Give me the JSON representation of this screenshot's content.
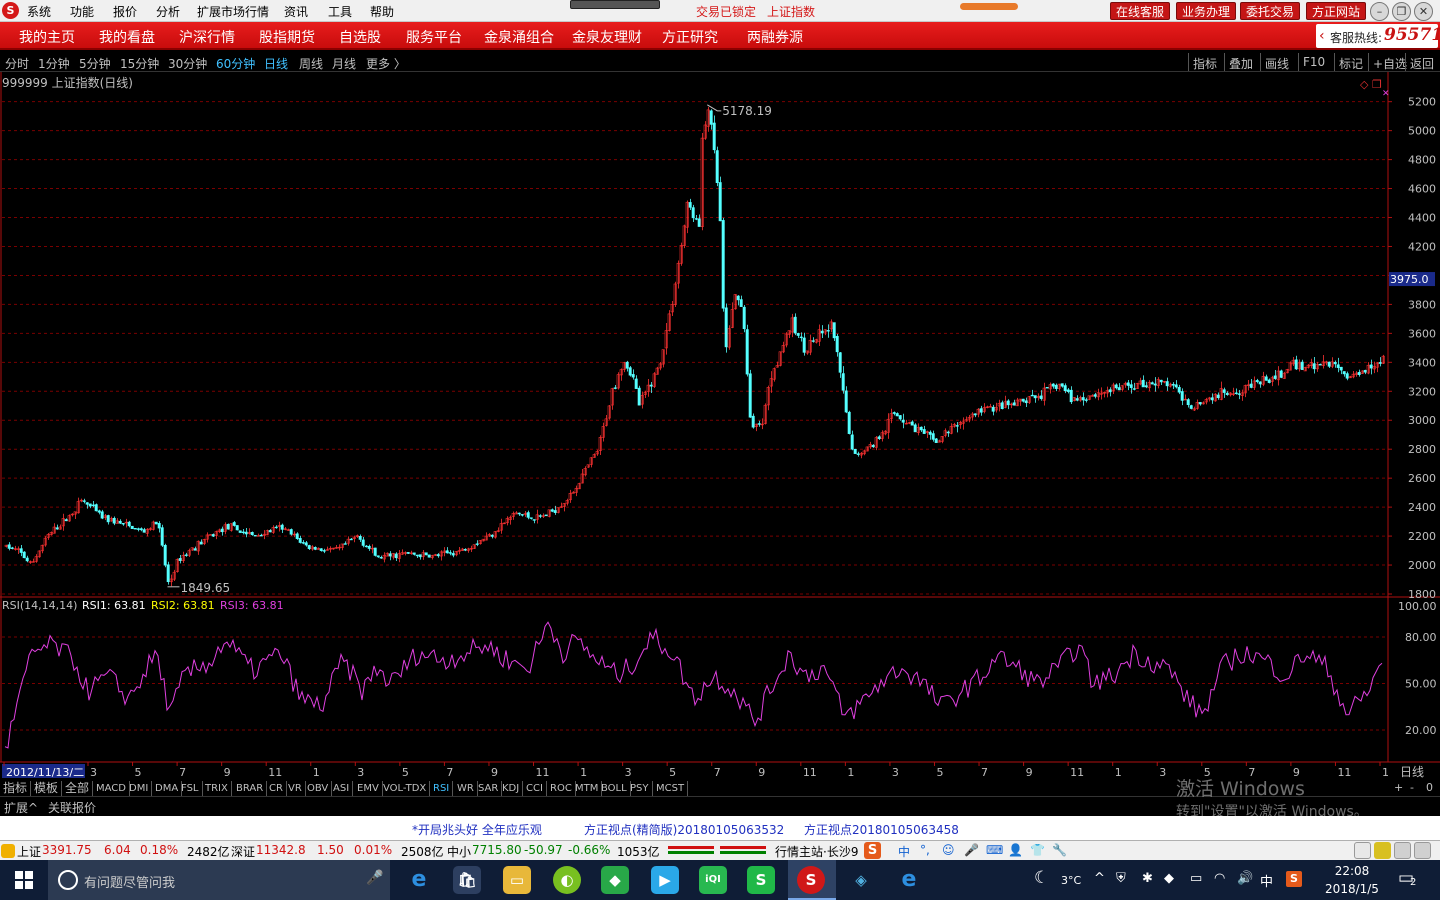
{
  "menubar": {
    "logo": "S",
    "items": [
      "系统",
      "功能",
      "报价",
      "分析",
      "扩展市场行情",
      "资讯",
      "工具",
      "帮助"
    ],
    "lock_status": "交易已锁定",
    "current_index": "上证指数",
    "buttons": [
      "在线客服",
      "业务办理",
      "委托交易",
      "方正网站"
    ]
  },
  "navbar": {
    "items": [
      "我的主页",
      "我的看盘",
      "沪深行情",
      "股指期货",
      "自选股",
      "服务平台",
      "金泉涌组合",
      "金泉友理财",
      "方正研究",
      "两融券源"
    ],
    "hotline_label": "客服热线:",
    "hotline_number": "95571"
  },
  "periodbar": {
    "periods": [
      "分时",
      "1分钟",
      "5分钟",
      "15分钟",
      "30分钟",
      "60分钟",
      "日线",
      "周线",
      "月线",
      "更多 〉"
    ],
    "active_period": "日线",
    "right_items": [
      "指标",
      "叠加",
      "画线",
      "F10",
      "标记",
      "+自选",
      "返回"
    ]
  },
  "chart_data": [
    {
      "type": "candlestick",
      "title": "999999 上证指数(日线)",
      "ylim": [
        1700,
        5300
      ],
      "y_ticks": [
        1800,
        2000,
        2200,
        2400,
        2600,
        2800,
        3000,
        3200,
        3400,
        3600,
        3800,
        4000,
        4200,
        4400,
        4600,
        4800,
        5000,
        5200
      ],
      "y_tick_labels": [
        "1800",
        "2000",
        "2200",
        "2400",
        "2600",
        "2800",
        "3000",
        "3200",
        "3400",
        "3600",
        "3800",
        "",
        "4200",
        "4400",
        "4600",
        "4800",
        "5000",
        "5200"
      ],
      "current_value": "3975.0",
      "high_annotation": "5178.19",
      "low_annotation": "1849.65",
      "high_value": 5178.19,
      "low_value": 1849.65,
      "price_path": [
        [
          0,
          2130
        ],
        [
          0.01,
          2090
        ],
        [
          0.018,
          2000
        ],
        [
          0.03,
          2200
        ],
        [
          0.045,
          2330
        ],
        [
          0.055,
          2450
        ],
        [
          0.07,
          2330
        ],
        [
          0.085,
          2280
        ],
        [
          0.1,
          2230
        ],
        [
          0.11,
          2300
        ],
        [
          0.118,
          1860
        ],
        [
          0.125,
          2040
        ],
        [
          0.14,
          2150
        ],
        [
          0.16,
          2270
        ],
        [
          0.18,
          2200
        ],
        [
          0.2,
          2260
        ],
        [
          0.22,
          2120
        ],
        [
          0.24,
          2100
        ],
        [
          0.255,
          2200
        ],
        [
          0.27,
          2050
        ],
        [
          0.29,
          2080
        ],
        [
          0.31,
          2060
        ],
        [
          0.33,
          2100
        ],
        [
          0.35,
          2200
        ],
        [
          0.37,
          2360
        ],
        [
          0.385,
          2320
        ],
        [
          0.395,
          2360
        ],
        [
          0.41,
          2480
        ],
        [
          0.43,
          2800
        ],
        [
          0.44,
          3200
        ],
        [
          0.448,
          3420
        ],
        [
          0.455,
          3300
        ],
        [
          0.46,
          3100
        ],
        [
          0.475,
          3400
        ],
        [
          0.485,
          3900
        ],
        [
          0.495,
          4500
        ],
        [
          0.505,
          4300
        ],
        [
          0.5,
          4600
        ],
        [
          0.51,
          5178
        ],
        [
          0.518,
          4500
        ],
        [
          0.522,
          3400
        ],
        [
          0.528,
          3850
        ],
        [
          0.535,
          3800
        ],
        [
          0.54,
          3000
        ],
        [
          0.548,
          2950
        ],
        [
          0.555,
          3300
        ],
        [
          0.57,
          3670
        ],
        [
          0.58,
          3500
        ],
        [
          0.6,
          3650
        ],
        [
          0.615,
          2750
        ],
        [
          0.63,
          2840
        ],
        [
          0.645,
          3050
        ],
        [
          0.66,
          2950
        ],
        [
          0.675,
          2850
        ],
        [
          0.69,
          2970
        ],
        [
          0.71,
          3080
        ],
        [
          0.73,
          3100
        ],
        [
          0.75,
          3170
        ],
        [
          0.765,
          3250
        ],
        [
          0.775,
          3140
        ],
        [
          0.79,
          3180
        ],
        [
          0.81,
          3230
        ],
        [
          0.83,
          3260
        ],
        [
          0.845,
          3250
        ],
        [
          0.86,
          3100
        ],
        [
          0.875,
          3160
        ],
        [
          0.89,
          3200
        ],
        [
          0.905,
          3250
        ],
        [
          0.92,
          3280
        ],
        [
          0.935,
          3380
        ],
        [
          0.95,
          3380
        ],
        [
          0.965,
          3390
        ],
        [
          0.975,
          3290
        ],
        [
          0.99,
          3380
        ],
        [
          1,
          3430
        ]
      ]
    },
    {
      "type": "line",
      "title": "RSI(14,14,14)",
      "ylim": [
        0,
        100
      ],
      "y_ticks": [
        20,
        50,
        80,
        100
      ],
      "y_tick_labels": [
        "20.00",
        "50.00",
        "80.00",
        "100.00"
      ],
      "series": [
        {
          "name": "RSI1",
          "value_label": "63.81",
          "color": "#ffffff"
        },
        {
          "name": "RSI2",
          "value_label": "63.81",
          "color": "#ffff00"
        },
        {
          "name": "RSI3",
          "value_label": "63.81",
          "color": "#e040e0"
        }
      ],
      "rsi_path": [
        [
          0,
          5
        ],
        [
          0.01,
          40
        ],
        [
          0.02,
          70
        ],
        [
          0.035,
          75
        ],
        [
          0.05,
          65
        ],
        [
          0.06,
          45
        ],
        [
          0.075,
          55
        ],
        [
          0.09,
          40
        ],
        [
          0.1,
          55
        ],
        [
          0.11,
          70
        ],
        [
          0.12,
          30
        ],
        [
          0.13,
          55
        ],
        [
          0.15,
          65
        ],
        [
          0.16,
          78
        ],
        [
          0.18,
          58
        ],
        [
          0.2,
          70
        ],
        [
          0.215,
          40
        ],
        [
          0.23,
          35
        ],
        [
          0.245,
          65
        ],
        [
          0.26,
          45
        ],
        [
          0.27,
          60
        ],
        [
          0.28,
          50
        ],
        [
          0.3,
          70
        ],
        [
          0.32,
          65
        ],
        [
          0.335,
          70
        ],
        [
          0.35,
          75
        ],
        [
          0.365,
          65
        ],
        [
          0.38,
          60
        ],
        [
          0.395,
          90
        ],
        [
          0.405,
          70
        ],
        [
          0.415,
          78
        ],
        [
          0.43,
          65
        ],
        [
          0.445,
          55
        ],
        [
          0.455,
          62
        ],
        [
          0.47,
          80
        ],
        [
          0.485,
          70
        ],
        [
          0.5,
          40
        ],
        [
          0.515,
          55
        ],
        [
          0.53,
          45
        ],
        [
          0.545,
          25
        ],
        [
          0.555,
          45
        ],
        [
          0.57,
          70
        ],
        [
          0.58,
          55
        ],
        [
          0.595,
          60
        ],
        [
          0.61,
          28
        ],
        [
          0.625,
          40
        ],
        [
          0.635,
          50
        ],
        [
          0.65,
          60
        ],
        [
          0.665,
          52
        ],
        [
          0.68,
          35
        ],
        [
          0.695,
          45
        ],
        [
          0.71,
          55
        ],
        [
          0.72,
          68
        ],
        [
          0.735,
          60
        ],
        [
          0.75,
          50
        ],
        [
          0.765,
          60
        ],
        [
          0.78,
          75
        ],
        [
          0.79,
          50
        ],
        [
          0.805,
          55
        ],
        [
          0.82,
          70
        ],
        [
          0.83,
          65
        ],
        [
          0.845,
          60
        ],
        [
          0.86,
          38
        ],
        [
          0.87,
          30
        ],
        [
          0.885,
          62
        ],
        [
          0.9,
          70
        ],
        [
          0.915,
          65
        ],
        [
          0.93,
          55
        ],
        [
          0.945,
          70
        ],
        [
          0.96,
          60
        ],
        [
          0.975,
          30
        ],
        [
          0.99,
          45
        ],
        [
          1,
          64
        ]
      ]
    }
  ],
  "xaxis": {
    "labels": [
      "2012/11/13/二",
      "3",
      "5",
      "7",
      "9",
      "11",
      "1",
      "3",
      "5",
      "7",
      "9",
      "11",
      "1",
      "3",
      "5",
      "7",
      "9",
      "11",
      "1",
      "3",
      "5",
      "7",
      "9",
      "11",
      "1",
      "3",
      "5",
      "7",
      "9",
      "11",
      "1"
    ],
    "period_label": "日线"
  },
  "indicator_tabs": {
    "first": [
      "指标",
      "模板",
      "全部"
    ],
    "items": [
      "MACD",
      "DMI",
      "DMA",
      "FSL",
      "TRIX",
      "BRAR",
      "CR",
      "VR",
      "OBV",
      "ASI",
      "EMV",
      "VOL-TDX",
      "RSI",
      "WR",
      "SAR",
      "KDJ",
      "CCI",
      "ROC",
      "MTM",
      "BOLL",
      "PSY",
      "MCST"
    ],
    "active": "RSI",
    "controls": [
      "+",
      "-",
      "0"
    ]
  },
  "ext": {
    "items": [
      "扩展^",
      "关联报价"
    ]
  },
  "watermark": {
    "line1": "激活 Windows",
    "line2": "转到\"设置\"以激活 Windows。"
  },
  "news": [
    "*开局兆头好 全年应乐观",
    "方正视点(精简版)20180105063532",
    "方正视点20180105063458"
  ],
  "ticker": {
    "sh_label": "上证",
    "sh_value": "3391.75",
    "sh_change": "6.04",
    "sh_pct": "0.18%",
    "sh_vol": "2482亿",
    "sz_label": "深证",
    "sz_value": "11342.8",
    "sz_change": "1.50",
    "sz_pct": "0.01%",
    "sz_vol": "2508亿",
    "zx_label": "中小",
    "zx_value": "7715.80",
    "zx_change": "-50.97",
    "zx_pct": "-0.66%",
    "zx_vol": "1053亿",
    "station": "行情主站·长沙9",
    "ime_items": [
      "中",
      "°,",
      "☺",
      "🎤",
      "⌨",
      "👤",
      "👕",
      "🔧"
    ]
  },
  "taskbar": {
    "search_placeholder": "有问题尽管问我",
    "weather": "3°C",
    "ime": "中",
    "time": "22:08",
    "date": "2018/1/5",
    "notifications": "2"
  },
  "colors": {
    "up": "#ff3232",
    "down": "#54ffff",
    "rsi": "#e040e0",
    "axis": "#b01010",
    "grid": "#7a0000"
  }
}
